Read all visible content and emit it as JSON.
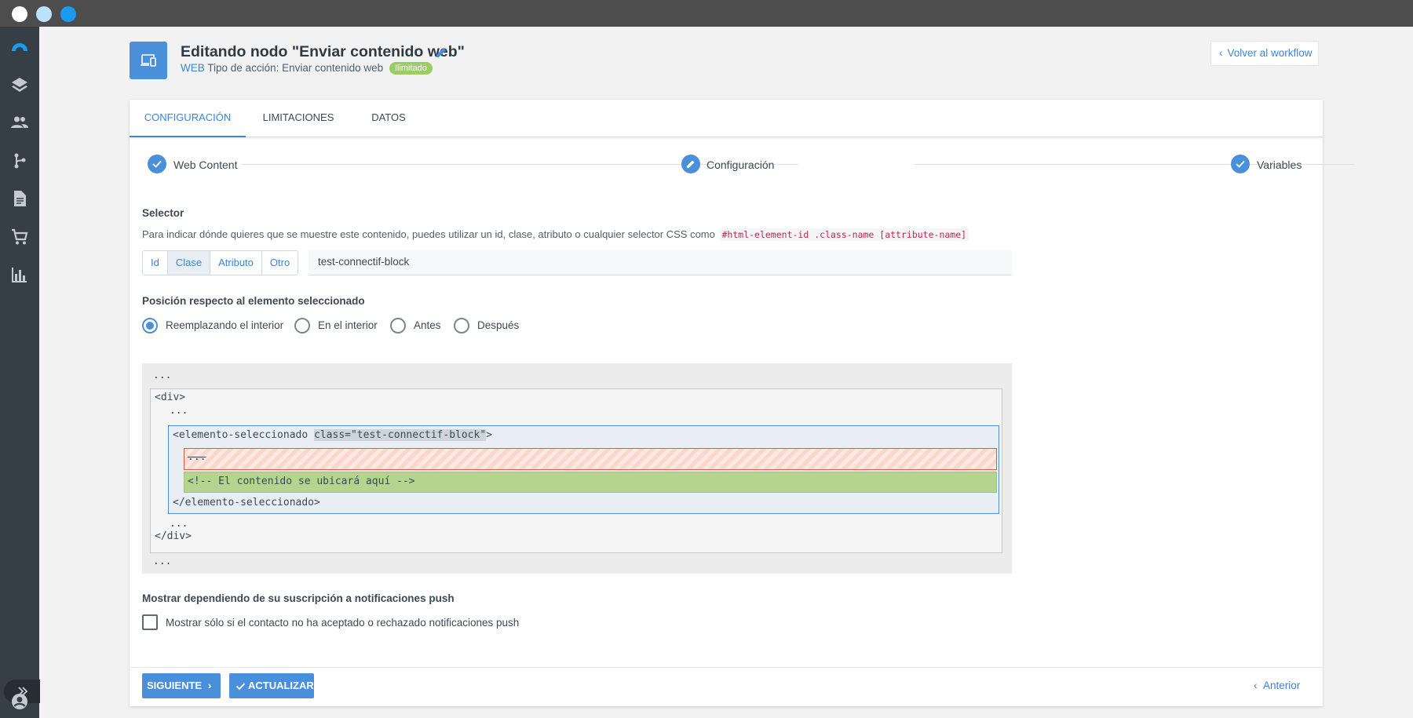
{
  "window": {
    "colors": {
      "close": "#ffffff",
      "minimize": "#bde3fb",
      "maximize": "#1a9bf0"
    }
  },
  "sidebar": {
    "items": [
      {
        "icon": "logo-icon"
      },
      {
        "icon": "layers-icon"
      },
      {
        "icon": "contacts-icon"
      },
      {
        "icon": "workflow-icon"
      },
      {
        "icon": "document-icon"
      },
      {
        "icon": "cart-icon"
      },
      {
        "icon": "chart-icon"
      }
    ],
    "expand_icon": "chevron-double-right-icon",
    "user_icon": "account-icon"
  },
  "header": {
    "title": "Editando nodo \"Enviar contenido web\"",
    "channel": "WEB",
    "action_type": "Tipo de acción: Enviar contenido web",
    "badge": "Ilimitado",
    "back_button": "Volver al workflow"
  },
  "tabs": [
    {
      "label": "CONFIGURACIÓN",
      "active": true
    },
    {
      "label": "LIMITACIONES",
      "active": false
    },
    {
      "label": "DATOS",
      "active": false
    }
  ],
  "steps": [
    {
      "label": "Web Content",
      "state": "done"
    },
    {
      "label": "Configuración",
      "state": "editing"
    },
    {
      "label": "Variables",
      "state": "done"
    }
  ],
  "selector": {
    "label": "Selector",
    "description": "Para indicar dónde quieres que se muestre este contenido, puedes utilizar un id, clase, atributo o cualquier selector CSS como",
    "example": "#html-element-id .class-name [attribute-name]",
    "types": [
      "Id",
      "Clase",
      "Atributo",
      "Otro"
    ],
    "selected_type": "Clase",
    "value": "test-connectif-block"
  },
  "position": {
    "label": "Posición respecto al elemento seleccionado",
    "options": [
      "Reemplazando el interior",
      "En el interior",
      "Antes",
      "Después"
    ],
    "selected": "Reemplazando el interior"
  },
  "preview": {
    "ellipsis": "...",
    "div_open": "<div>",
    "div_close": "</div>",
    "elem_open": "<elemento-seleccionado ",
    "elem_attr": "class=\"test-connectif-block\"",
    "elem_open_end": ">",
    "elem_close": "</elemento-seleccionado>",
    "replaced": "...",
    "comment": "<!-- El contenido se ubicará aquí -->"
  },
  "push": {
    "label": "Mostrar dependiendo de su suscripción a notificaciones push",
    "checkbox_label": "Mostrar sólo si el contacto no ha aceptado o rechazado notificaciones push",
    "checked": false
  },
  "footer": {
    "next": "SIGUIENTE",
    "update": "ACTUALIZAR",
    "previous": "Anterior"
  }
}
